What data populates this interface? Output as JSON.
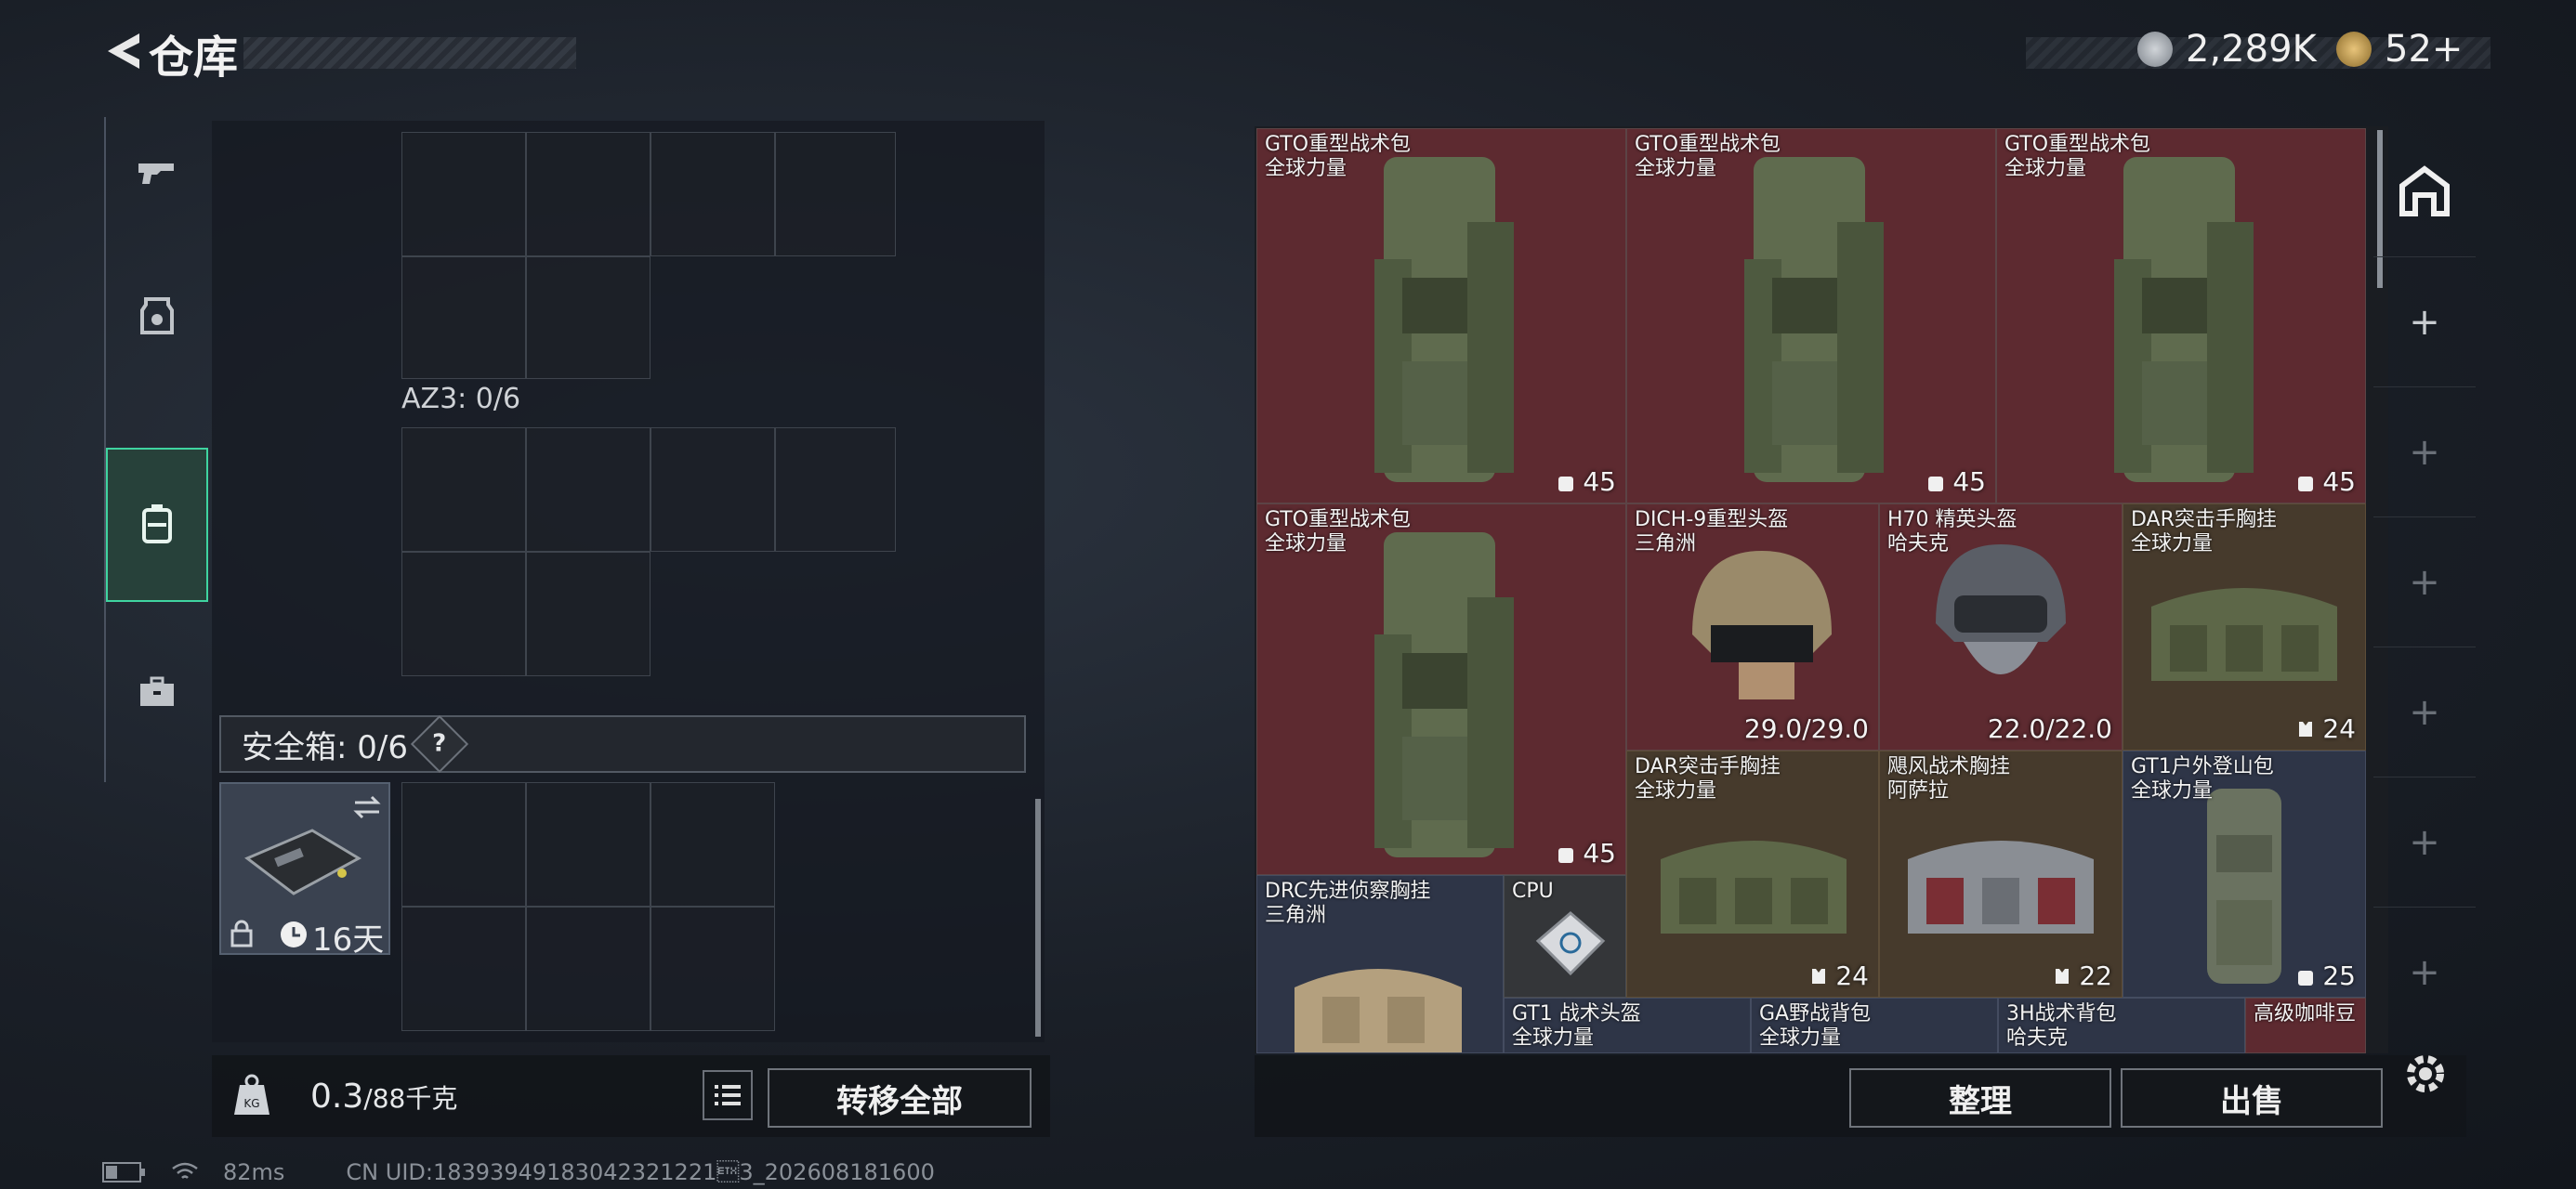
{
  "header": {
    "title": "仓库",
    "currency_1": "2,289K",
    "currency_2": "52+"
  },
  "left_nav": [
    "weapon-icon",
    "armor-icon",
    "backpack-icon",
    "toolbox-icon"
  ],
  "middle": {
    "az3_label": "AZ3: 0/6",
    "safe_label": "安全箱: 0/6",
    "safe_help": "?",
    "safe_timer": "16天",
    "weight_value": "0.3",
    "weight_max": "/88千克",
    "transfer_all": "转移全部"
  },
  "items": [
    {
      "name": "GTO重型战术包",
      "sub": "全球力量",
      "stat": "45",
      "stat_icon": "backpack-icon"
    },
    {
      "name": "GTO重型战术包",
      "sub": "全球力量",
      "stat": "45",
      "stat_icon": "backpack-icon"
    },
    {
      "name": "GTO重型战术包",
      "sub": "全球力量",
      "stat": "45",
      "stat_icon": "backpack-icon"
    },
    {
      "name": "GTO重型战术包",
      "sub": "全球力量",
      "stat": "45",
      "stat_icon": "backpack-icon"
    },
    {
      "name": "DICH-9重型头盔",
      "sub": "三角洲",
      "stat": "29.0/29.0",
      "stat_icon": ""
    },
    {
      "name": "H70 精英头盔",
      "sub": "哈夫克",
      "stat": "22.0/22.0",
      "stat_icon": ""
    },
    {
      "name": "DAR突击手胸挂",
      "sub": "全球力量",
      "stat": "24",
      "stat_icon": "vest-icon"
    },
    {
      "name": "DAR突击手胸挂",
      "sub": "全球力量",
      "stat": "24",
      "stat_icon": "vest-icon"
    },
    {
      "name": "飓风战术胸挂",
      "sub": "阿萨拉",
      "stat": "22",
      "stat_icon": "vest-icon"
    },
    {
      "name": "GT1户外登山包",
      "sub": "全球力量",
      "stat": "25",
      "stat_icon": "backpack-icon"
    },
    {
      "name": "DRC先进侦察胸挂",
      "sub": "三角洲",
      "stat": "",
      "stat_icon": ""
    },
    {
      "name": "CPU",
      "sub": "",
      "stat": "",
      "stat_icon": ""
    },
    {
      "name": "GT1 战术头盔",
      "sub": "全球力量",
      "stat": "",
      "stat_icon": ""
    },
    {
      "name": "GA野战背包",
      "sub": "全球力量",
      "stat": "",
      "stat_icon": ""
    },
    {
      "name": "3H战术背包",
      "sub": "哈夫克",
      "stat": "",
      "stat_icon": ""
    },
    {
      "name": "高级咖啡豆",
      "sub": "",
      "stat": "",
      "stat_icon": ""
    }
  ],
  "actions": {
    "sort": "整理",
    "sell": "出售"
  },
  "status": {
    "ping": "82ms",
    "uid": "CN UID:18393949183042321221\u00033_202608181600"
  }
}
